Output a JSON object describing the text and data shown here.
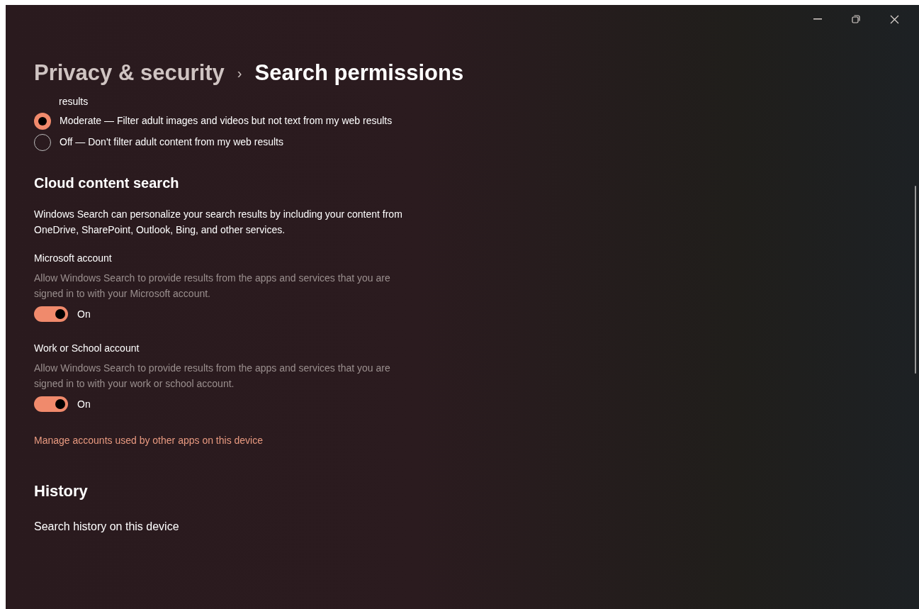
{
  "breadcrumb": {
    "parent": "Privacy & security",
    "separator": "›",
    "current": "Search permissions"
  },
  "safe_search": {
    "continued_text": "results",
    "options": [
      {
        "label": "Moderate — Filter adult images and videos but not text from my web results",
        "selected": true
      },
      {
        "label": "Off — Don't filter adult content from my web results",
        "selected": false
      }
    ]
  },
  "cloud": {
    "title": "Cloud content search",
    "description": "Windows Search can personalize your search results by including your content from OneDrive, SharePoint, Outlook, Bing, and other services.",
    "settings": [
      {
        "label": "Microsoft account",
        "description": "Allow Windows Search to provide results from the apps and services that you are signed in to with your Microsoft account.",
        "on": true,
        "state_text": "On"
      },
      {
        "label": "Work or School account",
        "description": "Allow Windows Search to provide results from the apps and services that you are signed in to with your work or school account.",
        "on": true,
        "state_text": "On"
      }
    ],
    "link": "Manage accounts used by other apps on this device"
  },
  "history": {
    "title": "History",
    "item": "Search history on this device"
  }
}
